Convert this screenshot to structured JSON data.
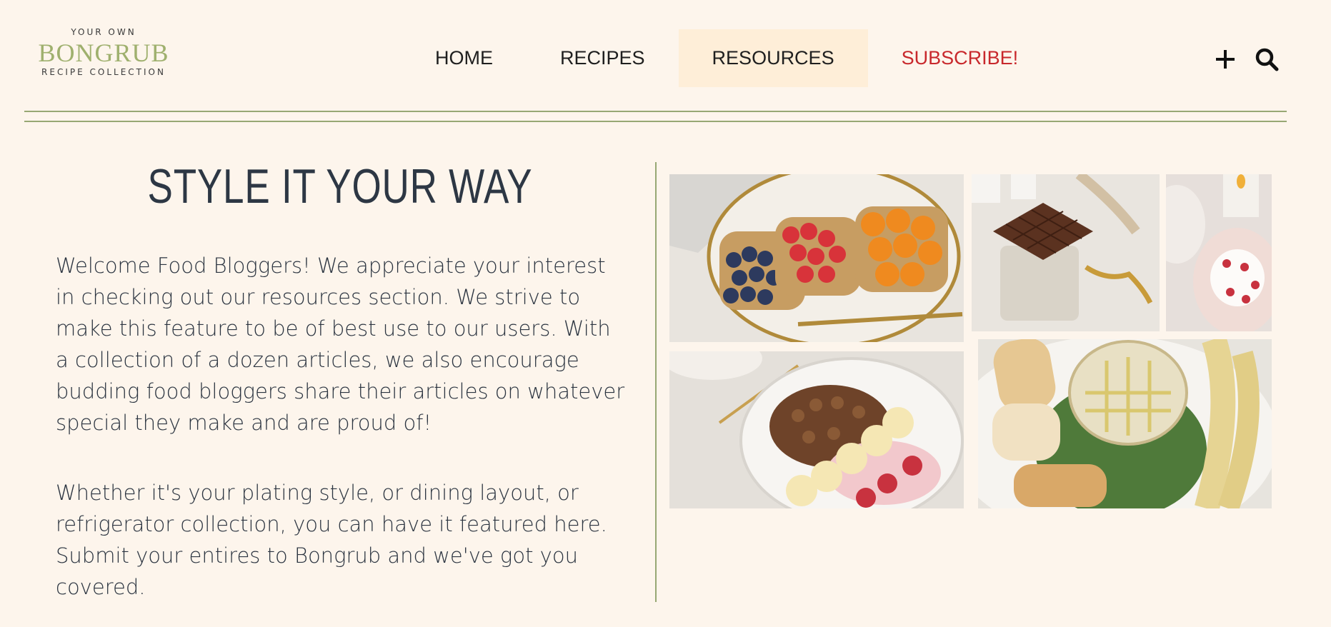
{
  "logo": {
    "top_text": "YOUR OWN",
    "brand": "BONGRUB",
    "bottom_text": "RECIPE COLLECTION"
  },
  "nav": {
    "items": [
      {
        "label": "HOME",
        "active": false
      },
      {
        "label": "RECIPES",
        "active": false
      },
      {
        "label": "RESOURCES",
        "active": true
      },
      {
        "label": "SUBSCRIBE!",
        "active": false
      }
    ]
  },
  "toolbar": {
    "add_icon": "plus-icon",
    "search_icon": "search-icon"
  },
  "main": {
    "heading": "STYLE IT YOUR WAY",
    "paragraph_1": "Welcome Food Bloggers! We appreciate your interest in checking out our resources section. We strive to make this feature to be of best use to our users. With a collection of a dozen articles, we also encourage budding food bloggers share their articles on whatever special they make and are proud of!",
    "paragraph_2": "Whether it's your plating style, or dining layout, or refrigerator collection, you can have it featured here. Submit your entires to Bongrub and we've got you covered."
  },
  "gallery": {
    "photos": [
      "toast-plate-photo",
      "chocolate-jar-photo",
      "dessert-plate-photo",
      "granola-bowl-photo",
      "cheese-board-photo"
    ]
  },
  "colors": {
    "background": "#fdf5ec",
    "accent_green": "#9fb06e",
    "active_nav_bg": "#feeed8",
    "subscribe_red": "#c8282c",
    "heading_text": "#2d3744"
  }
}
